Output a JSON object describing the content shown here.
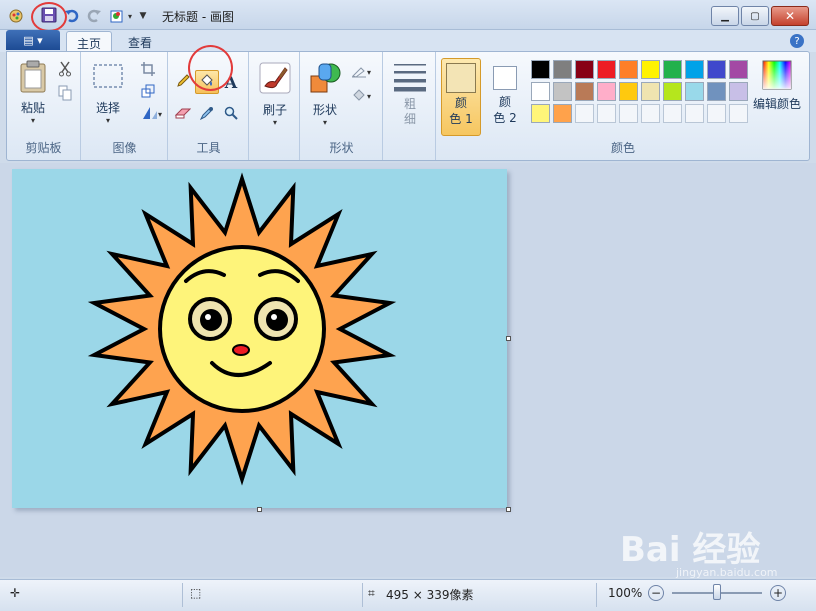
{
  "window": {
    "title": "无标题 - 画图"
  },
  "tabs": [
    {
      "label": "主页"
    },
    {
      "label": "查看"
    }
  ],
  "groups": {
    "clipboard": {
      "label": "剪贴板",
      "paste": "粘贴"
    },
    "image": {
      "label": "图像",
      "select": "选择"
    },
    "tools": {
      "label": "工具"
    },
    "brushes": {
      "label": "刷子"
    },
    "shapes": {
      "label": "形状",
      "shapes_btn": "形状"
    },
    "size": {
      "label": "粗\n细"
    },
    "colors": {
      "label": "颜色",
      "color1": "颜\n色 1",
      "color2": "颜\n色 2",
      "edit": "编辑颜色",
      "color1_value": "#f3e4b5",
      "color2_value": "#ffffff",
      "palette": [
        "#000000",
        "#7f7f7f",
        "#880015",
        "#ed1c24",
        "#ff7f27",
        "#fff200",
        "#22b14c",
        "#00a2e8",
        "#3f48cc",
        "#a349a4",
        "#ffffff",
        "#c3c3c3",
        "#b97a57",
        "#ffaec9",
        "#ffc90e",
        "#efe4b0",
        "#b5e61d",
        "#99d9ea",
        "#7092be",
        "#c8bfe7",
        "#fff579",
        "#ffa24b"
      ]
    }
  },
  "statusbar": {
    "dimensions": "495 × 339像素",
    "zoom": "100%"
  },
  "canvas": {
    "background": "#9bd7e8",
    "sun_body": "#fef47a",
    "sun_rays": "#fea34f"
  },
  "icons": [
    "app-icon",
    "save-icon",
    "undo-icon",
    "redo-icon",
    "paste-icon",
    "cut-icon",
    "copy-icon",
    "select-icon",
    "crop-icon",
    "resize-icon",
    "rotate-icon",
    "pencil-icon",
    "fill-icon",
    "text-icon",
    "eraser-icon",
    "color-picker-icon",
    "magnifier-icon",
    "brush-icon",
    "shapes-icon",
    "outline-icon",
    "shape-fill-icon",
    "edit-colors-icon",
    "move-icon",
    "selection-size-icon",
    "canvas-size-icon",
    "zoom-out-icon",
    "zoom-in-icon"
  ],
  "watermark": {
    "text": "Bai 经验",
    "sub": "jingyan.baidu.com"
  }
}
